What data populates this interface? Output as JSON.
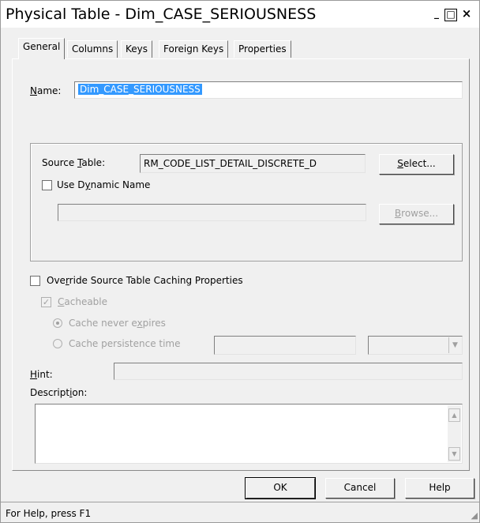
{
  "window": {
    "title": "Physical Table - Dim_CASE_SERIOUSNESS",
    "min_glyph": "_",
    "max_glyph": "□",
    "close_glyph": "×"
  },
  "tabs": [
    {
      "label": "General",
      "active": true
    },
    {
      "label": "Columns"
    },
    {
      "label": "Keys"
    },
    {
      "label": "Foreign Keys"
    },
    {
      "label": "Properties"
    }
  ],
  "general": {
    "name": {
      "label_pre": "",
      "label_key": "N",
      "label_post": "ame:",
      "value": "Dim_CASE_SERIOUSNESS"
    },
    "source_table": {
      "label_pre": "Source ",
      "label_key": "T",
      "label_post": "able:",
      "value": "RM_CODE_LIST_DETAIL_DISCRETE_D"
    },
    "select_button": {
      "label_key": "S",
      "label_post": "elect..."
    },
    "use_dynamic_name": {
      "label_pre": "Use D",
      "label_key": "y",
      "label_post": "namic Name",
      "checked": false
    },
    "dynamic_name_value": "",
    "browse_button": {
      "label_key": "B",
      "label_post": "rowse..."
    },
    "override_caching": {
      "label_pre": "Ove",
      "label_key": "r",
      "label_post": "ride Source Table Caching Properties",
      "checked": false
    },
    "cacheable": {
      "label_key": "C",
      "label_post": "acheable",
      "checked": true,
      "check_glyph": "✓"
    },
    "cache_never_expires": {
      "label_pre": "Cache never e",
      "label_key": "x",
      "label_post": "pires",
      "selected": true
    },
    "cache_persistence_time": {
      "label": "Cache persistence time",
      "selected": false,
      "value": "",
      "unit": ""
    },
    "hint": {
      "label_key": "H",
      "label_post": "int:",
      "value": ""
    },
    "description": {
      "label_pre": "Descript",
      "label_key": "i",
      "label_post": "on:",
      "value": ""
    }
  },
  "buttons": {
    "ok": "OK",
    "cancel": "Cancel",
    "help": "Help"
  },
  "status": {
    "text": "For Help, press F1"
  },
  "glyphs": {
    "combo_arrow": "▼",
    "scroll_up": "▲",
    "scroll_down": "▼",
    "grip": "◢"
  }
}
